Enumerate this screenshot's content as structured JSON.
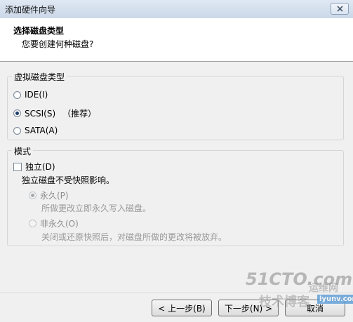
{
  "window": {
    "title": "添加硬件向导"
  },
  "header": {
    "title": "选择磁盘类型",
    "subtitle": "您要创建何种磁盘?"
  },
  "disk_type_group": {
    "title": "虚拟磁盘类型",
    "options": [
      {
        "label": "IDE(I)",
        "checked": false,
        "note": ""
      },
      {
        "label": "SCSI(S)",
        "checked": true,
        "note": "（推荐）"
      },
      {
        "label": "SATA(A)",
        "checked": false,
        "note": ""
      }
    ]
  },
  "mode_group": {
    "title": "模式",
    "independent_label": "独立(D)",
    "independent_checked": false,
    "description": "独立磁盘不受快照影响。",
    "options": [
      {
        "label": "永久(P)",
        "hint": "所做更改立即永久写入磁盘。",
        "checked": true,
        "enabled": false
      },
      {
        "label": "非永久(O)",
        "hint": "关闭或还原快照后，对磁盘所做的更改将被放弃。",
        "checked": false,
        "enabled": false
      }
    ]
  },
  "buttons": {
    "back": "< 上一步(B)",
    "next": "下一步(N) >",
    "cancel": "取消"
  },
  "watermark": {
    "text1": "51CTO.com",
    "text2": "技术博客",
    "text3": "运维网",
    "site": "iyunv.com"
  }
}
